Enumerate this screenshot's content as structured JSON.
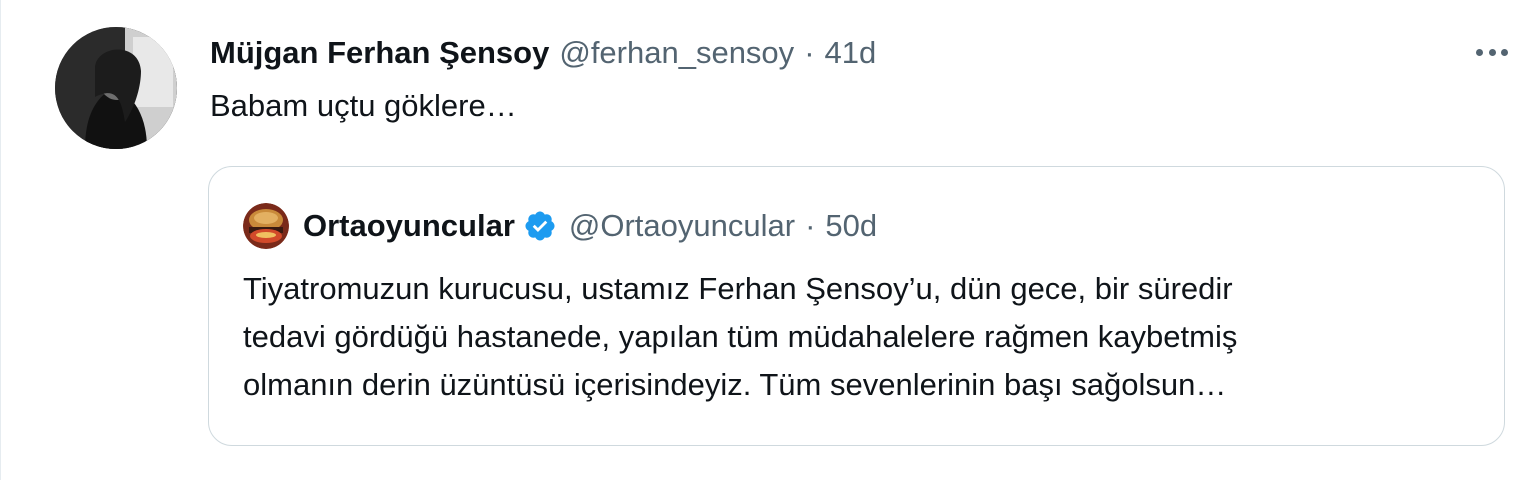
{
  "tweet": {
    "display_name": "Müjgan Ferhan Şensoy",
    "handle": "@ferhan_sensoy",
    "separator": "·",
    "time": "41d",
    "text": "Babam uçtu göklere…",
    "more_icon": "more-horizontal-icon"
  },
  "quote": {
    "display_name": "Ortaoyuncular",
    "verified_icon": "verified-badge-icon",
    "handle": "@Ortaoyuncular",
    "separator": "·",
    "time": "50d",
    "text_lines": [
      "Tiyatromuzun kurucusu, ustamız Ferhan Şensoy’u, dün gece, bir süredir",
      "tedavi gördüğü hastanede, yapılan tüm müdahalelere rağmen kaybetmiş",
      "olmanın derin üzüntüsü içerisindeyiz. Tüm sevenlerinin başı sağolsun…"
    ]
  },
  "colors": {
    "text_primary": "#0f1419",
    "text_secondary": "#536471",
    "border": "#cfd9de",
    "verified_blue": "#1d9bf0"
  }
}
